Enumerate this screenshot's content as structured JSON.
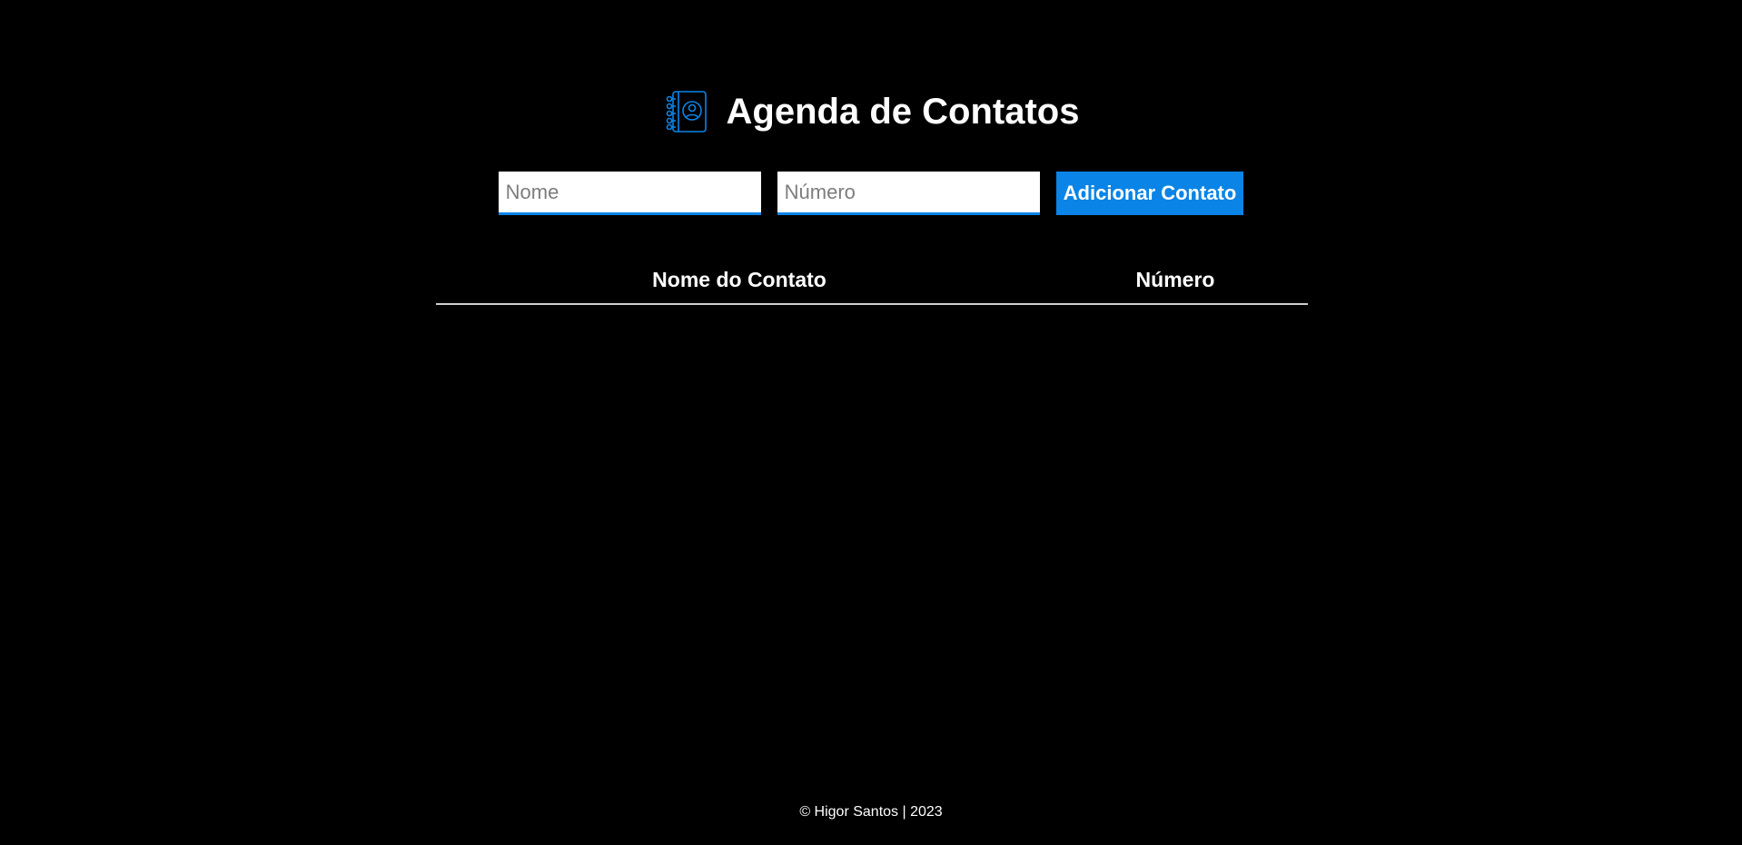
{
  "header": {
    "icon": "contact-book-icon",
    "title": "Agenda de Contatos"
  },
  "form": {
    "name_placeholder": "Nome",
    "number_placeholder": "Número",
    "name_value": "",
    "number_value": "",
    "submit_label": "Adicionar Contato"
  },
  "table": {
    "headers": [
      "Nome do Contato",
      "Número"
    ],
    "rows": []
  },
  "footer": {
    "text": "© Higor Santos | 2023"
  },
  "colors": {
    "background": "#000000",
    "accent": "#0a84e6",
    "text": "#ffffff"
  }
}
